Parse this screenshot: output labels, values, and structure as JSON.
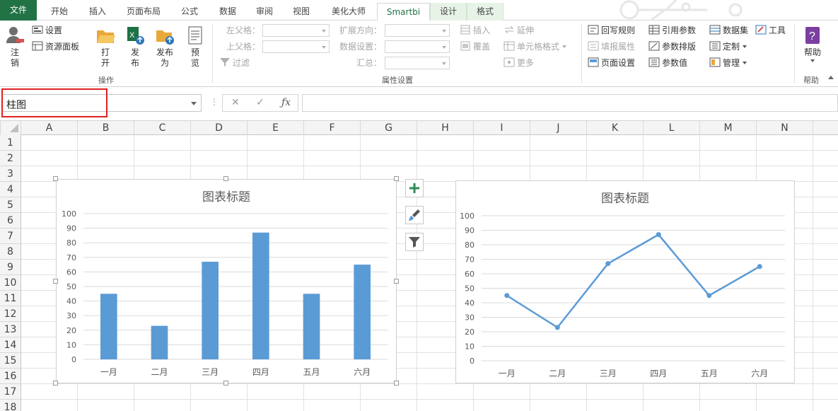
{
  "tabs": [
    "文件",
    "开始",
    "插入",
    "页面布局",
    "公式",
    "数据",
    "审阅",
    "视图",
    "美化大师",
    "Smartbi",
    "设计",
    "格式"
  ],
  "ribbon": {
    "logout": "注销",
    "settings": "设置",
    "resource_panel": "资源面板",
    "open": "打开",
    "publish": "发布",
    "publish_as": "发布为",
    "preview": "预览",
    "group_ops": "操作",
    "left_parent": "左父格：",
    "top_parent": "上父格：",
    "filter": "过滤",
    "expand_dir": "扩展方向：",
    "data_setting": "数据设置：",
    "summary": "汇总：",
    "insert": "插入",
    "cover": "覆盖",
    "extend": "延伸",
    "cell_format": "单元格格式",
    "more": "更多",
    "group_props": "属性设置",
    "writeback_rule": "回写规则",
    "fill_props": "填报属性",
    "page_setup": "页面设置",
    "ref_param": "引用参数",
    "param_layout": "参数排版",
    "param_value": "参数值",
    "dataset": "数据集",
    "customize": "定制",
    "manage": "管理",
    "tools": "工具",
    "help": "帮助",
    "group_help": "帮助"
  },
  "namebox": {
    "value": "柱图"
  },
  "columns": [
    "A",
    "B",
    "C",
    "D",
    "E",
    "F",
    "G",
    "H",
    "I",
    "J",
    "K",
    "L",
    "M",
    "N"
  ],
  "rows": [
    "1",
    "2",
    "3",
    "4",
    "5",
    "6",
    "7",
    "8",
    "9",
    "10",
    "11",
    "12",
    "13",
    "14",
    "15",
    "16",
    "17",
    "18"
  ],
  "colors": {
    "series": "#5b9bd5",
    "excel_green": "#217346",
    "highlight": "#e02020"
  },
  "chart_data": [
    {
      "type": "bar",
      "title": "图表标题",
      "categories": [
        "一月",
        "二月",
        "三月",
        "四月",
        "五月",
        "六月"
      ],
      "values": [
        45,
        23,
        67,
        87,
        45,
        65
      ],
      "yticks": [
        "0",
        "10",
        "20",
        "30",
        "40",
        "50",
        "60",
        "70",
        "80",
        "90",
        "100"
      ],
      "ylim": [
        0,
        100
      ],
      "grid": true
    },
    {
      "type": "line",
      "title": "图表标题",
      "categories": [
        "一月",
        "二月",
        "三月",
        "四月",
        "五月",
        "六月"
      ],
      "values": [
        45,
        23,
        67,
        87,
        45,
        65
      ],
      "yticks": [
        "0",
        "10",
        "20",
        "30",
        "40",
        "50",
        "60",
        "70",
        "80",
        "90",
        "100"
      ],
      "ylim": [
        0,
        100
      ],
      "grid": true
    }
  ]
}
